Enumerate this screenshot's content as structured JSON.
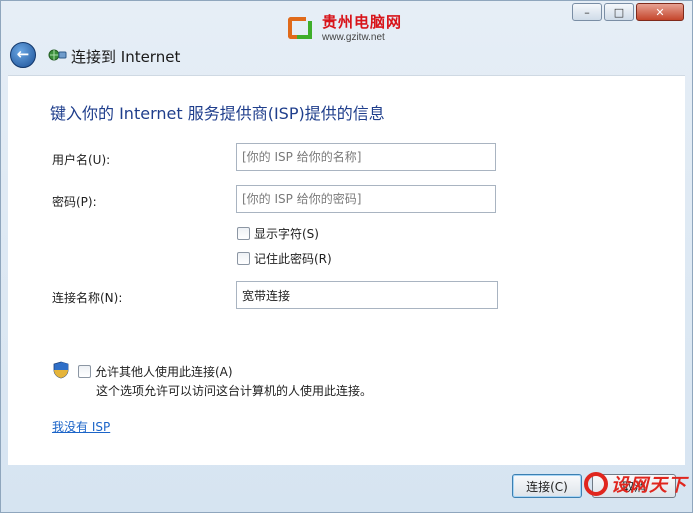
{
  "watermark_top": {
    "title": "贵州电脑网",
    "url": "www.gzitw.net"
  },
  "window_buttons": {
    "minimize_icon": "minimize-icon",
    "maximize_icon": "maximize-icon",
    "close_icon": "close-icon"
  },
  "nav": {
    "title": "连接到 Internet",
    "back_icon": "back-arrow-icon",
    "network_icon": "network-icon"
  },
  "form": {
    "heading": "键入你的 Internet 服务提供商(ISP)提供的信息",
    "username_label": "用户名(U):",
    "username_placeholder": "[你的 ISP 给你的名称]",
    "password_label": "密码(P):",
    "password_placeholder": "[你的 ISP 给你的密码]",
    "show_chars_label": "显示字符(S)",
    "remember_label": "记住此密码(R)",
    "connection_name_label": "连接名称(N):",
    "connection_name_value": "宽带连接",
    "allow_others_label": "允许其他人使用此连接(A)",
    "allow_others_desc": "这个选项允许可以访问这台计算机的人使用此连接。",
    "no_isp_link": "我没有 ISP"
  },
  "footer": {
    "connect_label": "连接(C)",
    "cancel_label": "取消"
  },
  "watermark_bottom": {
    "text": "设网天下"
  },
  "colors": {
    "heading": "#1f3e8c",
    "link": "#1b64c8",
    "watermark": "#e0261e"
  }
}
